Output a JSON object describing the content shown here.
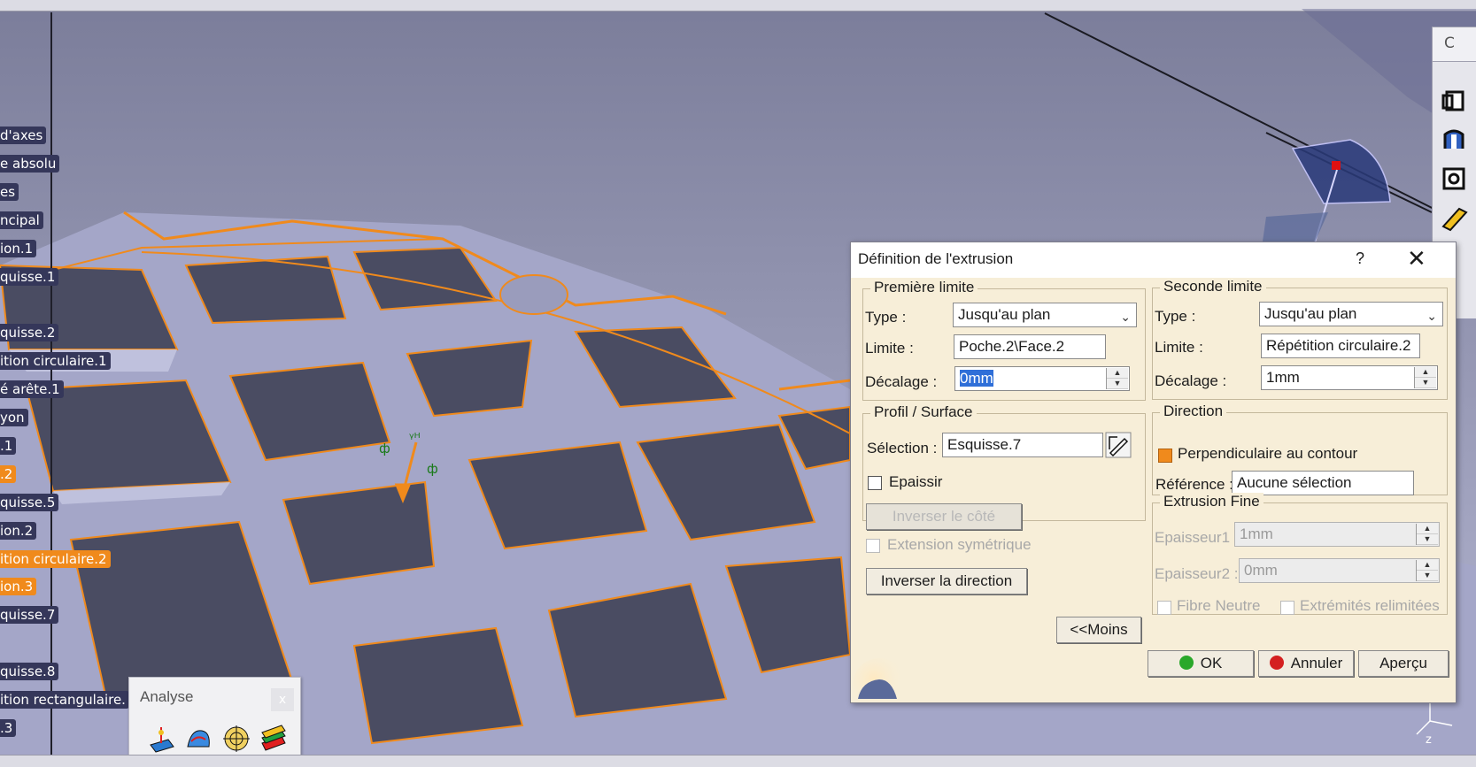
{
  "tree": {
    "items": [
      {
        "label": "d'axes",
        "selected": false
      },
      {
        "label": "e absolu",
        "selected": false
      },
      {
        "label": "es",
        "selected": false
      },
      {
        "label": "ncipal",
        "selected": false
      },
      {
        "label": "ion.1",
        "selected": false
      },
      {
        "label": "quisse.1",
        "selected": false
      },
      {
        "label": "",
        "selected": false
      },
      {
        "label": "quisse.2",
        "selected": false
      },
      {
        "label": "ition circulaire.1",
        "selected": false
      },
      {
        "label": "é arête.1",
        "selected": false
      },
      {
        "label": "yon",
        "selected": false
      },
      {
        "label": ".1",
        "selected": false
      },
      {
        "label": ".2",
        "selected": true
      },
      {
        "label": "quisse.5",
        "selected": false
      },
      {
        "label": "ion.2",
        "selected": false
      },
      {
        "label": "ition circulaire.2",
        "selected": true
      },
      {
        "label": "ion.3",
        "selected": true
      },
      {
        "label": "quisse.7",
        "selected": false
      },
      {
        "label": "",
        "selected": false
      },
      {
        "label": "quisse.8",
        "selected": false
      },
      {
        "label": "ition rectangulaire.",
        "selected": false
      },
      {
        "label": ".3",
        "selected": false
      }
    ]
  },
  "analyse_toolbar": {
    "title": "Analyse",
    "close": "x",
    "icons": [
      "draft-analysis-icon",
      "curvature-analysis-icon",
      "porcupine-analysis-icon",
      "thickness-analysis-icon"
    ]
  },
  "right_toolbar": {
    "top_label": "C",
    "icons": [
      "pad-icon",
      "groove-icon",
      "pocket-icon",
      "rib-icon"
    ]
  },
  "dialog": {
    "title": "Définition de l'extrusion",
    "help": "?",
    "close": "✕",
    "first_limit": {
      "group": "Première limite",
      "type_label": "Type :",
      "type_value": "Jusqu'au plan",
      "limit_label": "Limite :",
      "limit_value": "Poche.2\\Face.2",
      "offset_label": "Décalage :",
      "offset_value": "0mm"
    },
    "profile": {
      "group": "Profil / Surface",
      "selection_label": "Sélection :",
      "selection_value": "Esquisse.7",
      "thick_label": "Epaissir",
      "reverse_side": "Inverser le côté"
    },
    "symmetric_label": "Extension symétrique",
    "reverse_direction": "Inverser la direction",
    "less_button": "<<Moins",
    "second_limit": {
      "group": "Seconde limite",
      "type_label": "Type :",
      "type_value": "Jusqu'au plan",
      "limit_label": "Limite :",
      "limit_value": "Répétition circulaire.2",
      "offset_label": "Décalage :",
      "offset_value": "1mm"
    },
    "direction": {
      "group": "Direction",
      "normal_label": "Perpendiculaire au contour",
      "normal_checked": true,
      "reference_label": "Référence :",
      "reference_value": "Aucune sélection"
    },
    "thin": {
      "group": "Extrusion Fine",
      "thickness1_label": "Epaisseur1 :",
      "thickness1_value": "1mm",
      "thickness2_label": "Epaisseur2 :",
      "thickness2_value": "0mm",
      "neutral_label": "Fibre Neutre",
      "merge_label": "Extrémités relimitées"
    },
    "ok": "OK",
    "cancel": "Annuler",
    "preview": "Aperçu",
    "ok_color": "#2aa82a",
    "cancel_color": "#d42020"
  }
}
